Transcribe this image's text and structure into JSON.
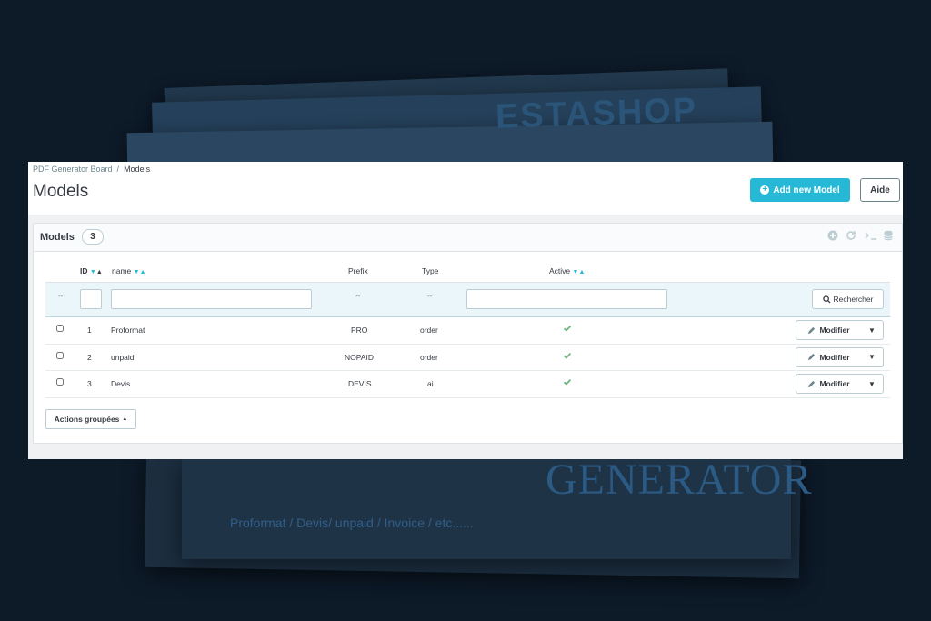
{
  "background": {
    "headline": "GENERATOR",
    "subline": "Proformat / Devis/ unpaid / Invoice / etc......",
    "topword": "ESTASHOP"
  },
  "breadcrumb": {
    "root": "PDF Generator Board",
    "separator": "/",
    "current": "Models"
  },
  "page_title": "Models",
  "toolbar": {
    "add_label": "Add new Model",
    "help_label": "Aide"
  },
  "card": {
    "title": "Models",
    "count": "3",
    "header_icons": [
      "add-circle-icon",
      "refresh-icon",
      "terminal-icon",
      "database-icon"
    ]
  },
  "table": {
    "columns": {
      "id": "ID",
      "name": "name",
      "prefix": "Prefix",
      "type": "Type",
      "active": "Active"
    },
    "filters": {
      "select_all": "--",
      "prefix": "--",
      "type": "--",
      "search_label": "Rechercher"
    },
    "rows": [
      {
        "id": "1",
        "name": "Proformat",
        "prefix": "PRO",
        "type": "order",
        "active": true
      },
      {
        "id": "2",
        "name": "unpaid",
        "prefix": "NOPAID",
        "type": "order",
        "active": true
      },
      {
        "id": "3",
        "name": "Devis",
        "prefix": "DEVIS",
        "type": "ai",
        "active": true
      }
    ],
    "row_action_label": "Modifier"
  },
  "bulk_actions_label": "Actions groupées",
  "colors": {
    "primary": "#25b9d7",
    "success": "#70b580",
    "text": "#363a41"
  }
}
